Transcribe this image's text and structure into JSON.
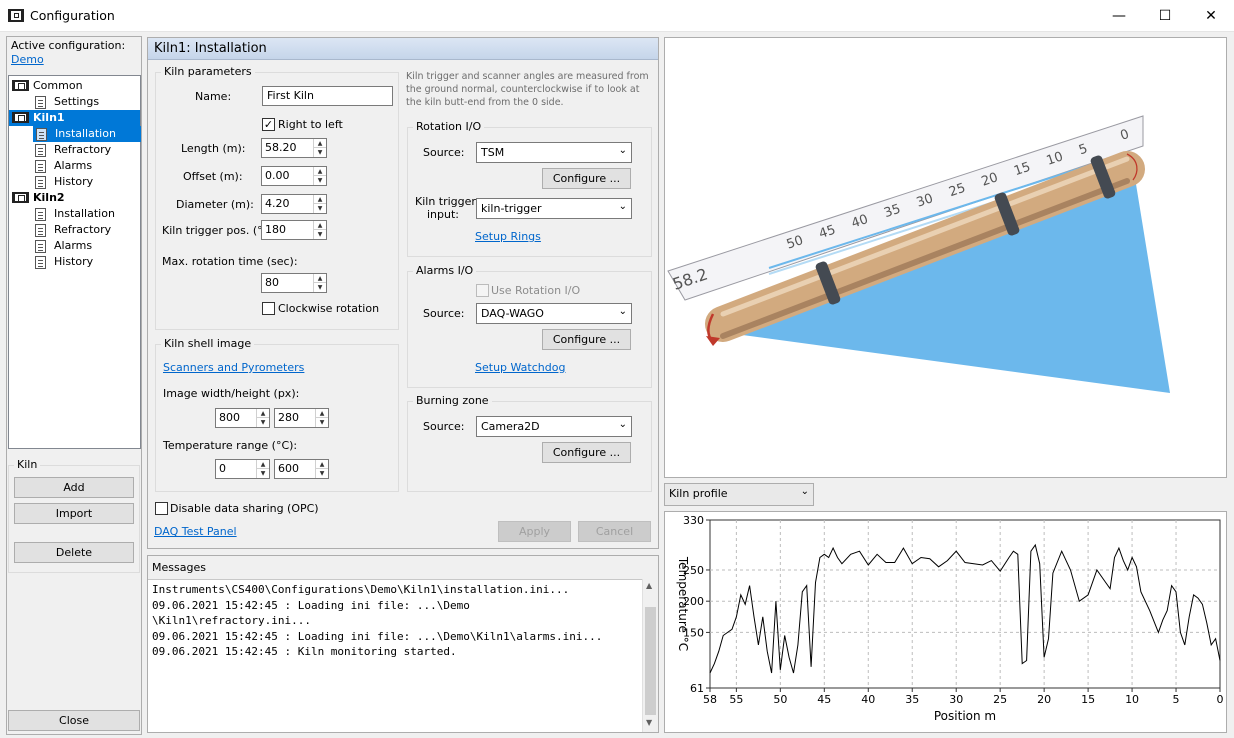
{
  "window": {
    "title": "Configuration",
    "minimize_glyph": "—",
    "maximize_glyph": "☐",
    "close_glyph": "✕"
  },
  "left": {
    "active_label": "Active configuration:",
    "active_value": "Demo",
    "tree": [
      {
        "label": "Common",
        "icon": "kiln-icon"
      },
      {
        "label": "Settings",
        "icon": "document-icon"
      },
      {
        "label": "Kiln1",
        "icon": "kiln-icon"
      },
      {
        "label": "Installation",
        "icon": "document-icon"
      },
      {
        "label": "Refractory",
        "icon": "document-icon"
      },
      {
        "label": "Alarms",
        "icon": "document-icon"
      },
      {
        "label": "History",
        "icon": "document-icon"
      },
      {
        "label": "Kiln2",
        "icon": "kiln-icon"
      },
      {
        "label": "Installation",
        "icon": "document-icon"
      },
      {
        "label": "Refractory",
        "icon": "document-icon"
      },
      {
        "label": "Alarms",
        "icon": "document-icon"
      },
      {
        "label": "History",
        "icon": "document-icon"
      }
    ],
    "kiln_group": "Kiln",
    "add": "Add",
    "import": "Import",
    "delete": "Delete",
    "close": "Close"
  },
  "center": {
    "header": "Kiln1: Installation",
    "kiln_params": {
      "title": "Kiln parameters",
      "name_label": "Name:",
      "name_value": "First Kiln",
      "right_to_left": "Right to left",
      "length_label": "Length (m):",
      "length_value": "58.20",
      "offset_label": "Offset (m):",
      "offset_value": "0.00",
      "diameter_label": "Diameter (m):",
      "diameter_value": "4.20",
      "trigger_label": "Kiln trigger pos. (°):",
      "trigger_value": "180",
      "rot_time_label": "Max. rotation time (sec):",
      "rot_time_value": "80",
      "clockwise": "Clockwise rotation"
    },
    "note": "Kiln trigger and scanner angles are measured from the ground normal, counterclockwise if to look at the kiln butt-end from the 0 side.",
    "rotation_io": {
      "title": "Rotation I/O",
      "source_label": "Source:",
      "source_value": "TSM",
      "configure": "Configure ...",
      "trigger_input_label_1": "Kiln trigger",
      "trigger_input_label_2": "input:",
      "trigger_input_value": "kiln-trigger",
      "setup_rings": "Setup Rings"
    },
    "alarms_io": {
      "title": "Alarms I/O",
      "use_rotation": "Use Rotation I/O",
      "source_label": "Source:",
      "source_value": "DAQ-WAGO",
      "configure": "Configure ...",
      "setup_watchdog": "Setup Watchdog"
    },
    "shell_image": {
      "title": "Kiln shell image",
      "scanners_link": "Scanners and Pyrometers",
      "size_label": "Image width/height (px):",
      "width_value": "800",
      "height_value": "280",
      "temp_label": "Temperature range (°C):",
      "temp_min": "0",
      "temp_max": "600"
    },
    "burning_zone": {
      "title": "Burning zone",
      "source_label": "Source:",
      "source_value": "Camera2D",
      "configure": "Configure ..."
    },
    "disable_sharing": "Disable data sharing (OPC)",
    "daq_link": "DAQ Test Panel",
    "apply": "Apply",
    "cancel": "Cancel"
  },
  "messages": {
    "title": "Messages",
    "lines": [
      "Instruments\\CS400\\Configurations\\Demo\\Kiln1\\installation.ini...",
      "09.06.2021 15:42:45 : Loading ini file: ...\\Demo",
      "\\Kiln1\\refractory.ini...",
      "09.06.2021 15:42:45 : Loading ini file: ...\\Demo\\Kiln1\\alarms.ini...",
      "09.06.2021 15:42:45 : Kiln monitoring started."
    ]
  },
  "view3d": {
    "ruler_labels": [
      "58.2",
      "50",
      "45",
      "40",
      "35",
      "30",
      "25",
      "20",
      "15",
      "10",
      "5",
      "0"
    ],
    "colors": {
      "kiln": "#d2aa7f",
      "ring": "#444a52",
      "scan": "#6cb8ec",
      "arrow": "#c0392b"
    }
  },
  "profile": {
    "select_value": "Kiln profile",
    "chart_data": {
      "type": "line",
      "xlabel": "Position m",
      "ylabel": "Temperature °C",
      "x_reversed": true,
      "xlim": [
        58,
        0
      ],
      "ylim": [
        61,
        330
      ],
      "x_ticks": [
        58,
        55,
        50,
        45,
        40,
        35,
        30,
        25,
        20,
        15,
        10,
        5,
        0
      ],
      "y_ticks": [
        61,
        150,
        200,
        250,
        330
      ],
      "grid": true,
      "series": [
        {
          "x": [
            58,
            57.5,
            57,
            56.5,
            56,
            55.5,
            55,
            54.5,
            54,
            53.5,
            53,
            52.5,
            52,
            51.5,
            51,
            50.5,
            50,
            49.5,
            49,
            48.5,
            48,
            47.5,
            47,
            46.5,
            46,
            45.5,
            45,
            44.5,
            44,
            43.5,
            43,
            42,
            41,
            40,
            39,
            38,
            37,
            36,
            35,
            34,
            33,
            32,
            31,
            30,
            29,
            28,
            27,
            26,
            25,
            24,
            23.5,
            23,
            22.5,
            22,
            21.5,
            21,
            20.5,
            20,
            19.5,
            19,
            18,
            17,
            16,
            15,
            14,
            13,
            12.5,
            12,
            11.5,
            11,
            10.5,
            10,
            9.5,
            9,
            8,
            7,
            6.5,
            6,
            5.5,
            5,
            4.5,
            4,
            3.5,
            3,
            2.5,
            2,
            1.5,
            1,
            0.5,
            0
          ],
          "y": [
            85,
            100,
            120,
            145,
            150,
            155,
            175,
            210,
            195,
            225,
            175,
            130,
            175,
            120,
            85,
            200,
            90,
            145,
            110,
            85,
            130,
            215,
            225,
            95,
            230,
            270,
            275,
            270,
            285,
            270,
            260,
            275,
            280,
            258,
            275,
            262,
            262,
            285,
            260,
            270,
            268,
            255,
            265,
            280,
            262,
            260,
            258,
            265,
            248,
            270,
            280,
            275,
            100,
            105,
            280,
            290,
            260,
            110,
            140,
            245,
            280,
            250,
            200,
            210,
            250,
            230,
            220,
            270,
            285,
            265,
            250,
            270,
            255,
            215,
            185,
            150,
            170,
            185,
            225,
            215,
            150,
            130,
            175,
            210,
            205,
            195,
            165,
            130,
            140,
            105
          ]
        }
      ]
    }
  }
}
